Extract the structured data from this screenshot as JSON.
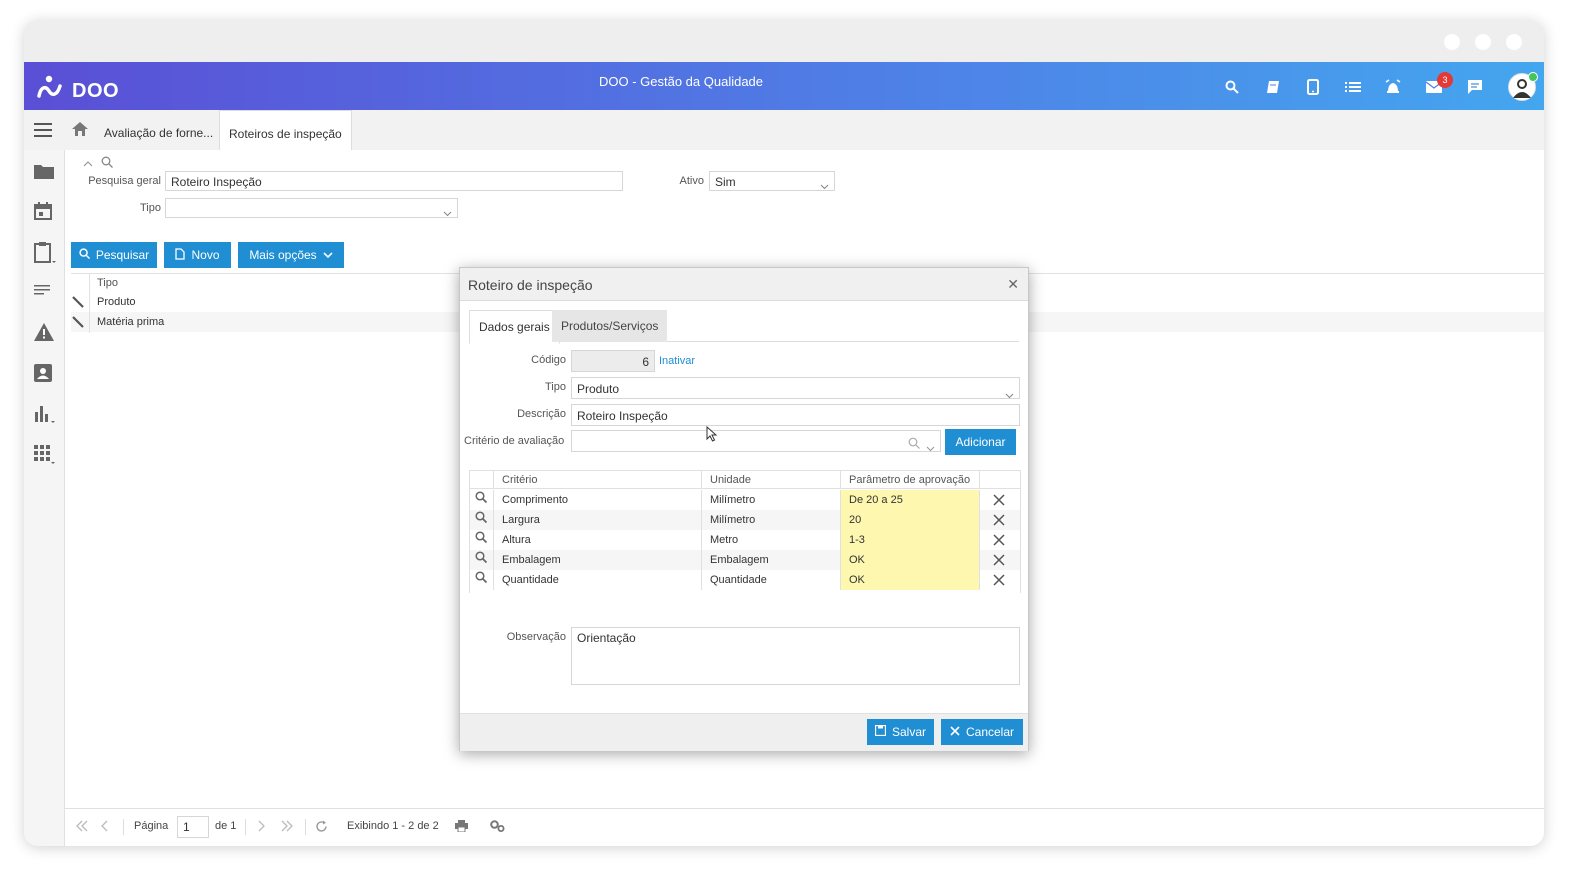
{
  "app": {
    "logo_text": "DOO",
    "title": "DOO - Gestão da Qualidade",
    "notification_count": "3",
    "colors": {
      "primary": "#1f8ed3",
      "header_start": "#5a4fd6",
      "header_end": "#44a6ef",
      "badge": "#e53935",
      "highlight": "#fdf7b0"
    }
  },
  "tabs": {
    "items": [
      {
        "label": "Avaliação de forne..."
      },
      {
        "label": "Roteiros de inspeção"
      }
    ]
  },
  "filters": {
    "search_label": "Pesquisa geral",
    "search_value": "Roteiro Inspeção",
    "type_label": "Tipo",
    "type_value": "",
    "active_label": "Ativo",
    "active_value": "Sim"
  },
  "toolbar": {
    "search_label": "Pesquisar",
    "new_label": "Novo",
    "more_label": "Mais opções"
  },
  "grid": {
    "header_type": "Tipo",
    "rows": [
      {
        "type": "Produto"
      },
      {
        "type": "Matéria prima"
      }
    ]
  },
  "pager": {
    "page_label": "Página",
    "page_value": "1",
    "of_label": "de 1",
    "showing": "Exibindo 1 - 2 de 2"
  },
  "modal": {
    "title": "Roteiro de inspeção",
    "tabs": [
      {
        "label": "Dados gerais"
      },
      {
        "label": "Produtos/Serviços"
      }
    ],
    "code_label": "Código",
    "code_value": "6",
    "inactivate_link": "Inativar",
    "type_label": "Tipo",
    "type_value": "Produto",
    "description_label": "Descrição",
    "description_value": "Roteiro Inspeção",
    "criterion_label": "Critério de avaliação",
    "criterion_value": "",
    "add_label": "Adicionar",
    "table_headers": {
      "criterion": "Critério",
      "unit": "Unidade",
      "param": "Parâmetro de aprovação"
    },
    "table_rows": [
      {
        "criterion": "Comprimento",
        "unit": "Milímetro",
        "param": "De 20 a 25"
      },
      {
        "criterion": "Largura",
        "unit": "Milímetro",
        "param": "20"
      },
      {
        "criterion": "Altura",
        "unit": "Metro",
        "param": "1-3"
      },
      {
        "criterion": "Embalagem",
        "unit": "Embalagem",
        "param": "OK"
      },
      {
        "criterion": "Quantidade",
        "unit": "Quantidade",
        "param": "OK"
      }
    ],
    "notes_label": "Observação",
    "notes_value": "Orientação",
    "save_label": "Salvar",
    "cancel_label": "Cancelar"
  }
}
